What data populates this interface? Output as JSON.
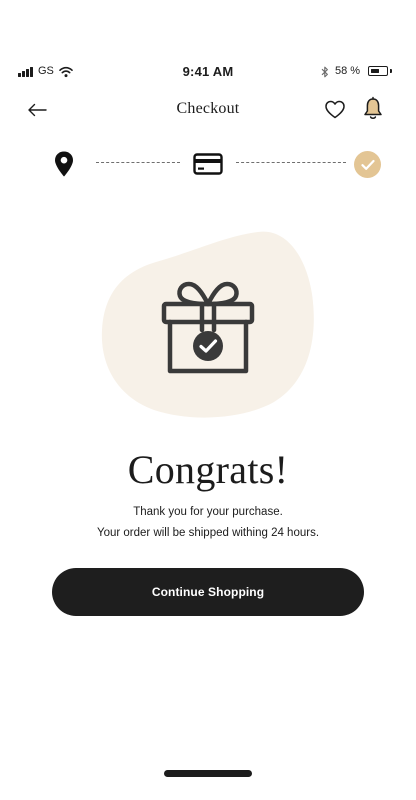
{
  "status_bar": {
    "carrier": "GS",
    "time": "9:41 AM",
    "battery_percent": "58 %",
    "battery_level": 0.58,
    "icons": [
      "signal-icon",
      "wifi-icon",
      "bluetooth-icon",
      "battery-icon"
    ]
  },
  "header": {
    "title": "Checkout",
    "icons": [
      "back-arrow-icon",
      "heart-icon",
      "bell-icon"
    ]
  },
  "steps": {
    "icons": [
      "location-pin-icon",
      "credit-card-icon",
      "check-circle-icon"
    ],
    "completed_color": "#e3c594"
  },
  "illustration": {
    "icon": "gift-check-icon",
    "blob_color": "#f7f1e8"
  },
  "confirmation": {
    "headline": "Congrats!",
    "line1": "Thank you for your purchase.",
    "line2": "Your order will be shipped withing 24 hours."
  },
  "actions": {
    "continue_label": "Continue Shopping"
  },
  "colors": {
    "primary": "#1e1e1e",
    "accent": "#e3c594",
    "background": "#ffffff"
  }
}
